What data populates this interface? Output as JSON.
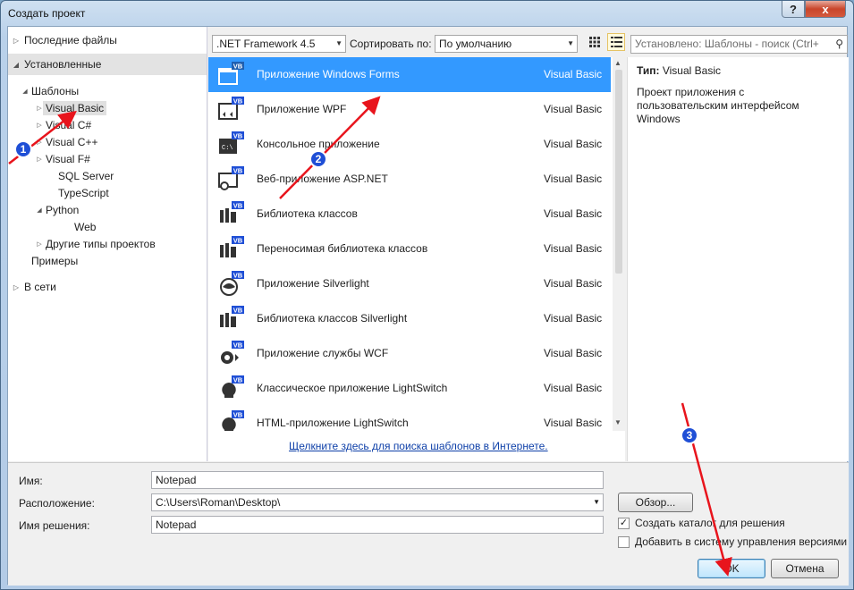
{
  "window": {
    "title": "Создать проект",
    "help_glyph": "?",
    "close_glyph": "x"
  },
  "left_nav": {
    "recent": "Последние файлы",
    "installed": "Установленные",
    "tree": [
      {
        "label": "Шаблоны",
        "indent": 0,
        "expanded": true
      },
      {
        "label": "Visual Basic",
        "indent": 1,
        "selected": true
      },
      {
        "label": "Visual C#",
        "indent": 1
      },
      {
        "label": "Visual C++",
        "indent": 1
      },
      {
        "label": "Visual F#",
        "indent": 1
      },
      {
        "label": "SQL Server",
        "indent": 2
      },
      {
        "label": "TypeScript",
        "indent": 2
      },
      {
        "label": "Python",
        "indent": 1,
        "expanded": true
      },
      {
        "label": "Web",
        "indent": 3
      },
      {
        "label": "Другие типы проектов",
        "indent": 1
      },
      {
        "label": "Примеры",
        "indent": 0
      }
    ],
    "online": "В сети"
  },
  "toolbar": {
    "framework": ".NET Framework 4.5",
    "sort_label": "Сортировать по:",
    "sort_value": "По умолчанию",
    "search_placeholder": "Установлено: Шаблоны - поиск (Ctrl+"
  },
  "templates": [
    {
      "name": "Приложение Windows Forms",
      "lang": "Visual Basic",
      "icon": "windows-forms-icon",
      "selected": true
    },
    {
      "name": "Приложение WPF",
      "lang": "Visual Basic",
      "icon": "wpf-icon"
    },
    {
      "name": "Консольное приложение",
      "lang": "Visual Basic",
      "icon": "console-icon"
    },
    {
      "name": "Веб-приложение ASP.NET",
      "lang": "Visual Basic",
      "icon": "web-icon"
    },
    {
      "name": "Библиотека классов",
      "lang": "Visual Basic",
      "icon": "class-library-icon"
    },
    {
      "name": "Переносимая библиотека классов",
      "lang": "Visual Basic",
      "icon": "portable-library-icon"
    },
    {
      "name": "Приложение Silverlight",
      "lang": "Visual Basic",
      "icon": "silverlight-icon"
    },
    {
      "name": "Библиотека классов Silverlight",
      "lang": "Visual Basic",
      "icon": "silverlight-library-icon"
    },
    {
      "name": "Приложение службы WCF",
      "lang": "Visual Basic",
      "icon": "wcf-icon"
    },
    {
      "name": "Классическое приложение LightSwitch",
      "lang": "Visual Basic",
      "icon": "lightswitch-icon"
    },
    {
      "name": "HTML-приложение LightSwitch",
      "lang": "Visual Basic",
      "icon": "lightswitch-html-icon"
    }
  ],
  "icon_badge": "VB",
  "online_link": "Щелкните здесь для поиска шаблонов в Интернете.",
  "details": {
    "type_label": "Тип:",
    "type_value": "Visual Basic",
    "description": "Проект приложения с пользовательским интерфейсом Windows"
  },
  "form": {
    "name_label": "Имя:",
    "name_value": "Notepad",
    "location_label": "Расположение:",
    "location_value": "C:\\Users\\Roman\\Desktop\\",
    "solution_label": "Имя решения:",
    "solution_value": "Notepad",
    "browse": "Обзор...",
    "create_dir": "Создать каталог для решения",
    "create_dir_checked": true,
    "add_vcs": "Добавить в систему управления версиями",
    "add_vcs_checked": false,
    "ok": "OK",
    "cancel": "Отмена"
  },
  "annotations": {
    "badges": [
      "1",
      "2",
      "3"
    ],
    "arrow_color": "#e8141c",
    "badge_color": "#1f4fd6"
  },
  "colors": {
    "selection": "#3399ff",
    "link": "#0d3fa8"
  }
}
